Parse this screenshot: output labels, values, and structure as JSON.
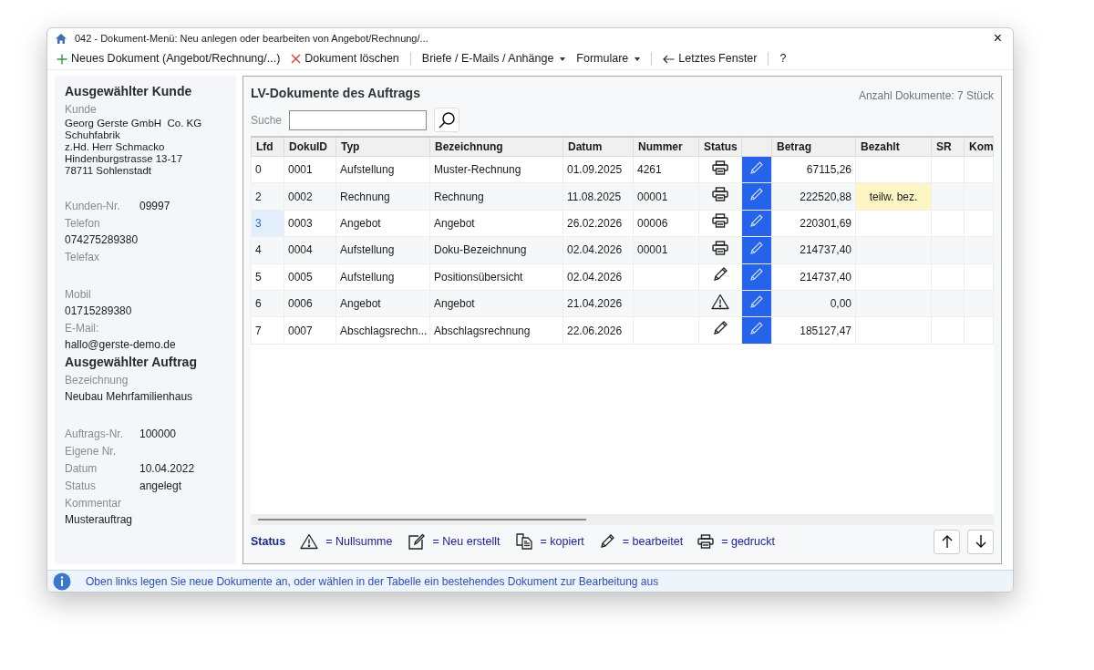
{
  "window": {
    "title": "042  -  Dokument-Menü: Neu anlegen oder bearbeiten von Angebot/Rechnung/...",
    "close": "×"
  },
  "toolbar": {
    "groups": [
      [
        {
          "kind": "new",
          "label": "Neues Dokument (Angebot/Rechnung/...)"
        },
        {
          "kind": "delete",
          "label": "Dokument löschen"
        }
      ],
      [
        {
          "kind": "menu",
          "label": "Briefe / E-Mails / Anhänge"
        },
        {
          "kind": "menu",
          "label": "Formulare"
        }
      ],
      [
        {
          "kind": "back",
          "label": "Letztes Fenster"
        }
      ],
      [
        {
          "kind": "plain",
          "label": "?"
        }
      ]
    ]
  },
  "sidebar": {
    "sections": [
      {
        "title": "Ausgewählter Kunde",
        "groups": [
          [
            {
              "kind": "stacked",
              "label": "Kunde",
              "value_lines": [
                "Georg Gerste GmbH  Co. KG",
                "Schuhfabrik",
                "z.Hd. Herr Schmacko",
                "Hindenburgstrasse 13-17",
                "78711 Sohlenstadt"
              ]
            }
          ],
          [
            {
              "kind": "inline",
              "label": "Kunden-Nr.",
              "value_lines": [
                "09997"
              ]
            },
            {
              "kind": "stacked",
              "label": "Telefon",
              "value_lines": [
                "074275289380"
              ]
            },
            {
              "kind": "stacked",
              "label": "Telefax"
            }
          ],
          [
            {
              "kind": "stacked",
              "label": "Mobil",
              "value_lines": [
                "01715289380"
              ]
            },
            {
              "kind": "stacked",
              "label": "E-Mail:",
              "value_lines": [
                "hallo@gerste-demo.de"
              ]
            }
          ]
        ]
      },
      {
        "title": "Ausgewählter Auftrag",
        "groups": [
          [
            {
              "kind": "stacked",
              "label": "Bezeichnung",
              "value_lines": [
                "Neubau Mehrfamilienhaus"
              ]
            }
          ],
          [
            {
              "kind": "inline",
              "label": "Auftrags-Nr.",
              "value_lines": [
                "100000"
              ]
            },
            {
              "kind": "inline",
              "label": "Eigene Nr."
            },
            {
              "kind": "inline",
              "label": "Datum",
              "value_lines": [
                "10.04.2022"
              ]
            },
            {
              "kind": "inline",
              "label": "Status",
              "value_lines": [
                "angelegt"
              ]
            },
            {
              "kind": "stacked",
              "label": "Kommentar",
              "value_lines": [
                "Musterauftrag"
              ]
            }
          ]
        ]
      }
    ]
  },
  "panel": {
    "title": "LV-Dokumente des Auftrags",
    "count": "Anzahl Dokumente: 7 Stück",
    "search": {
      "label": "Suche"
    },
    "table": {
      "columns": [
        "Lfd",
        "DokuID",
        "Typ",
        "Bezeichnung",
        "Datum",
        "Nummer",
        "Status",
        "",
        "Betrag",
        "Bezahlt",
        "SR",
        "Kom"
      ],
      "rows": [
        {
          "lfd": "0",
          "dokuid": "0001",
          "typ": "Aufstellung",
          "bezeichnung": "Muster-Rechnung",
          "datum": "01.09.2025",
          "nummer": "4261",
          "status": {
            "kind": "printed"
          },
          "betrag": "67115,26",
          "bezahlt": "",
          "selected": false
        },
        {
          "lfd": "2",
          "dokuid": "0002",
          "typ": "Rechnung",
          "bezeichnung": "Rechnung",
          "datum": "11.08.2025",
          "nummer": "00001",
          "status": {
            "kind": "printed"
          },
          "betrag": "222520,88",
          "bezahlt": "teilw. bez.",
          "selected": false
        },
        {
          "lfd": "3",
          "dokuid": "0003",
          "typ": "Angebot",
          "bezeichnung": "Angebot",
          "datum": "26.02.2026",
          "nummer": "00006",
          "status": {
            "kind": "printed"
          },
          "betrag": "220301,69",
          "bezahlt": "",
          "selected": true
        },
        {
          "lfd": "4",
          "dokuid": "0004",
          "typ": "Aufstellung",
          "bezeichnung": "Doku-Bezeichnung",
          "datum": "02.04.2026",
          "nummer": "00001",
          "status": {
            "kind": "printed"
          },
          "betrag": "214737,40",
          "bezahlt": "",
          "selected": false
        },
        {
          "lfd": "5",
          "dokuid": "0005",
          "typ": "Aufstellung",
          "bezeichnung": "Positionsübersicht",
          "datum": "02.04.2026",
          "nummer": "",
          "status": {
            "kind": "edited"
          },
          "betrag": "214737,40",
          "bezahlt": "",
          "selected": false
        },
        {
          "lfd": "6",
          "dokuid": "0006",
          "typ": "Angebot",
          "bezeichnung": "Angebot",
          "datum": "21.04.2026",
          "nummer": "",
          "status": {
            "kind": "zero"
          },
          "betrag": "0,00",
          "bezahlt": "",
          "selected": false
        },
        {
          "lfd": "7",
          "dokuid": "0007",
          "typ": "Abschlagsrechn...",
          "bezeichnung": "Abschlagsrechnung",
          "datum": "22.06.2026",
          "nummer": "",
          "status": {
            "kind": "edited"
          },
          "betrag": "185127,47",
          "bezahlt": "",
          "selected": false
        }
      ]
    },
    "legend": {
      "title": "Status",
      "items": [
        {
          "kind": "zero",
          "label": "= Nullsumme"
        },
        {
          "kind": "new",
          "label": "= Neu erstellt"
        },
        {
          "kind": "copied",
          "label": "= kopiert"
        },
        {
          "kind": "edited",
          "label": "= bearbeitet"
        },
        {
          "kind": "printed",
          "label": "= gedruckt"
        }
      ]
    }
  },
  "status_bar": {
    "text": "Oben links legen Sie neue Dokumente an, oder wählen in der Tabelle ein bestehendes Dokument zur Bearbeitung aus"
  }
}
